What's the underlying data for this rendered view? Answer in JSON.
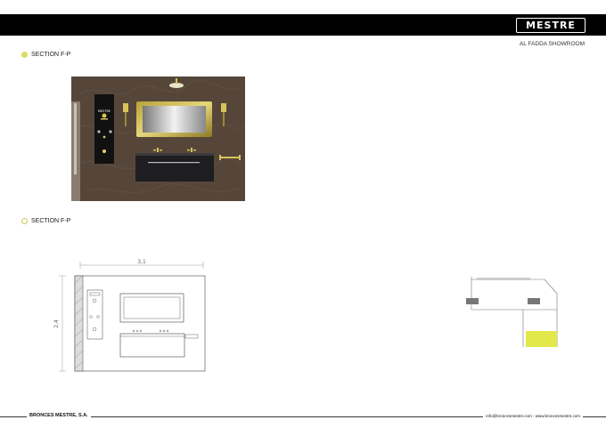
{
  "header": {
    "brand": "MESTRE",
    "showroom": "AL FADDA SHOWROOM"
  },
  "sections": [
    {
      "label": "SECTION F-P"
    },
    {
      "label": "SECTION F-P"
    }
  ],
  "render_panel": {
    "brand": "MESTRE"
  },
  "elevation": {
    "width_dim": "3,1",
    "height_dim": "2,4"
  },
  "footer": {
    "company": "BRONCES MESTRE, S.A.",
    "contact": "info@broncesmestre.com - www.broncesmestre.com"
  },
  "colors": {
    "accent": "#d6dc64",
    "wall": "#5a4a3b",
    "bar": "#000000"
  }
}
